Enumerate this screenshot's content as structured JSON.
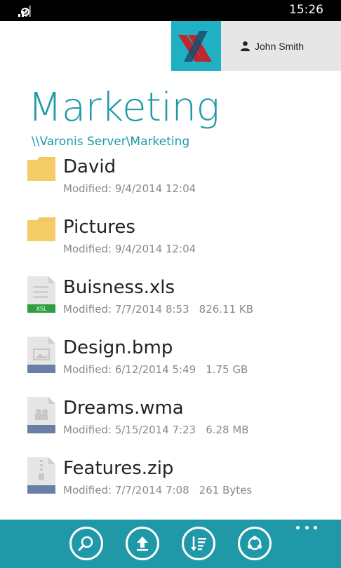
{
  "status_bar": {
    "time": "15:26"
  },
  "account": {
    "user_name": "John Smith"
  },
  "folder": {
    "title": "Marketing",
    "path": "\\\\Varonis Server\\Marketing"
  },
  "files": [
    {
      "name": "David",
      "modified": "Modified: 9/4/2014 12:04",
      "size": "",
      "type": "folder"
    },
    {
      "name": "Pictures",
      "modified": "Modified: 9/4/2014 12:04",
      "size": "",
      "type": "folder"
    },
    {
      "name": "Buisness.xls",
      "modified": "Modified: 7/7/2014 8:53",
      "size": "826.11 KB",
      "type": "xls",
      "badge": "XSL"
    },
    {
      "name": "Design.bmp",
      "modified": "Modified: 6/12/2014 5:49",
      "size": "1.75 GB",
      "type": "image"
    },
    {
      "name": "Dreams.wma",
      "modified": "Modified: 5/15/2014 7:23",
      "size": "6.28 MB",
      "type": "audio"
    },
    {
      "name": "Features.zip",
      "modified": "Modified: 7/7/2014 7:08",
      "size": "261 Bytes",
      "type": "zip"
    }
  ],
  "app_bar": {
    "buttons": [
      "search-icon",
      "upload-icon",
      "sort-icon",
      "share-icon"
    ],
    "more": "more-icon"
  },
  "colors": {
    "accent": "#1f99a8",
    "logo_bg": "#1fb0c3",
    "folder": "#f3c85f",
    "xls_badge": "#2f9e41",
    "file_band": "#6a7fa5"
  }
}
